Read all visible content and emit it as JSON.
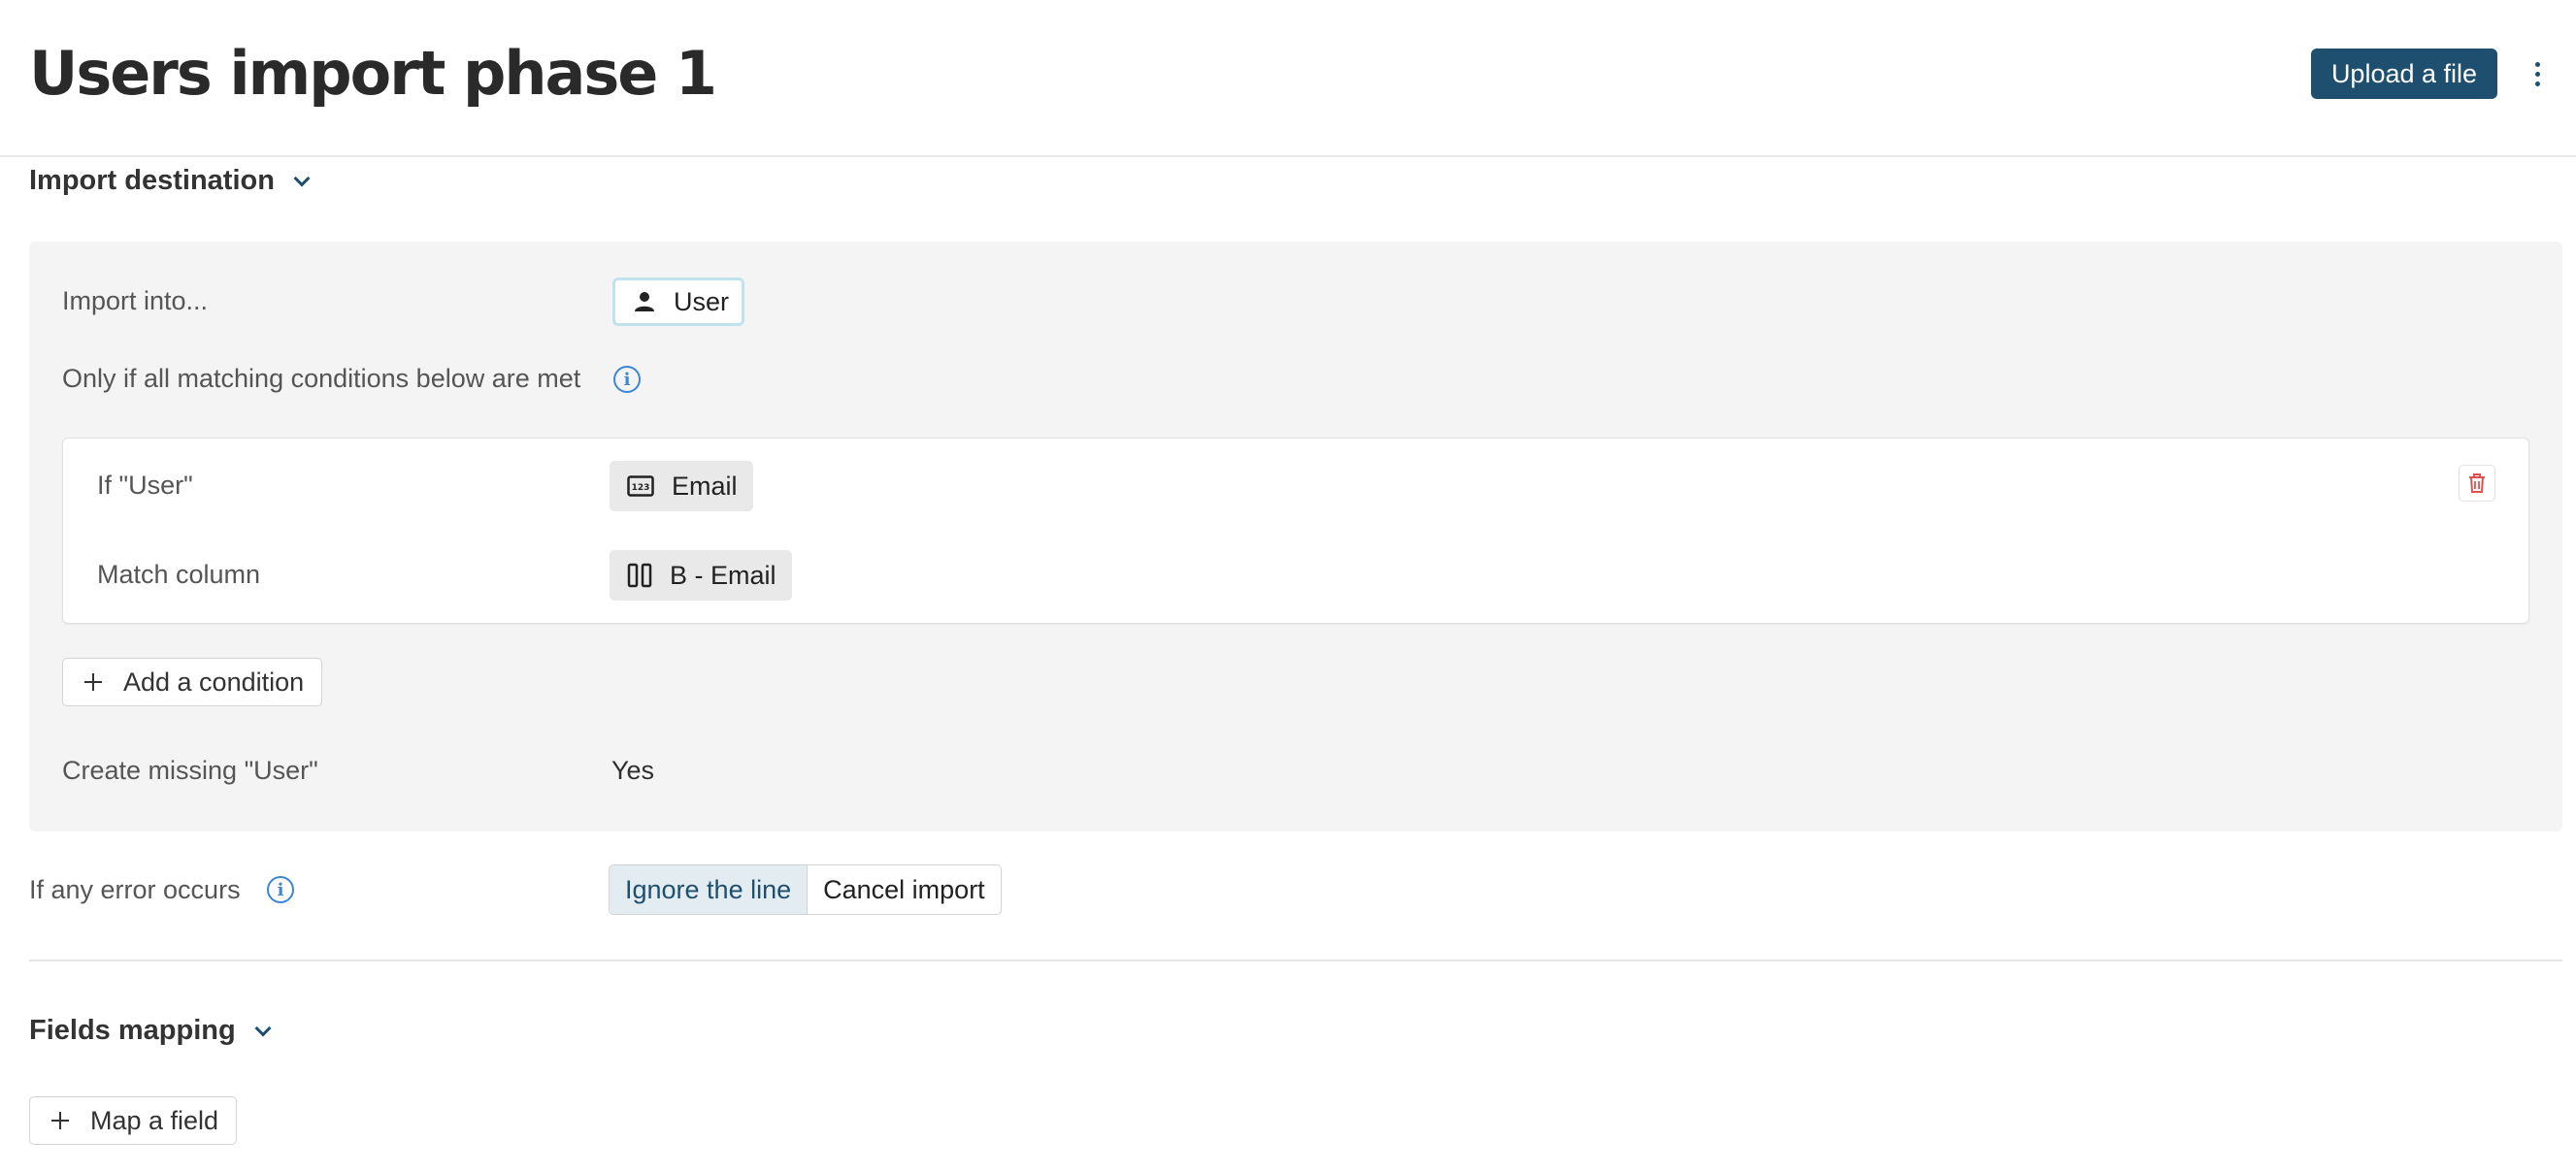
{
  "header": {
    "title": "Users import phase 1",
    "upload_label": "Upload a file",
    "menu_icon": "more-vertical-icon"
  },
  "import_destination": {
    "heading": "Import destination",
    "import_into_label": "Import into...",
    "import_into_value": "User",
    "import_into_icon": "user-icon",
    "conditions_label": "Only if all matching conditions below are met",
    "condition": {
      "if_label": "If \"User\"",
      "field_value": "Email",
      "field_icon": "number-field-icon",
      "match_label": "Match column",
      "column_value": "B - Email",
      "column_icon": "column-icon",
      "delete_icon": "trash-icon"
    },
    "add_condition_label": "Add a condition",
    "create_missing_label": "Create missing \"User\"",
    "create_missing_value": "Yes"
  },
  "error_handling": {
    "label": "If any error occurs",
    "options": [
      "Ignore the line",
      "Cancel import"
    ],
    "selected": "Ignore the line"
  },
  "fields_mapping": {
    "heading": "Fields mapping",
    "map_field_label": "Map a field"
  },
  "colors": {
    "primary": "#1e4f6e",
    "info": "#3b86d6",
    "danger": "#e05252",
    "panel_bg": "#f4f4f4"
  }
}
